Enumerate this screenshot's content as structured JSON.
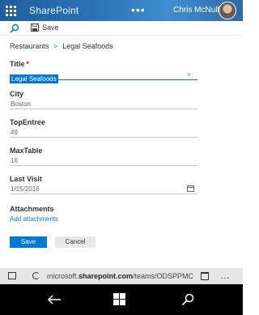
{
  "suitebar": {
    "app_name": "SharePoint",
    "more": "•••",
    "user_name": "Chris McNulty",
    "waffle_icon": "app-launcher-icon"
  },
  "commandbar": {
    "search_icon": "search-icon",
    "save_label": "Save"
  },
  "breadcrumb": {
    "list": "Restaurants",
    "separator": ">",
    "item": "Legal Seafoods"
  },
  "form": {
    "title_label": "Title",
    "title_required": "*",
    "title_value": "Legal Seafoods",
    "city_label": "City",
    "city_value": "Boston",
    "topentree_label": "TopEntree",
    "topentree_value": "49",
    "maxtable_label": "MaxTable",
    "maxtable_value": "16",
    "lastvisit_label": "Last Visit",
    "lastvisit_value": "1/15/2016",
    "attachments_label": "Attachments",
    "add_attachments": "Add attachments"
  },
  "buttons": {
    "save": "Save",
    "cancel": "Cancel"
  },
  "browser": {
    "url_prefix": "microsoft.",
    "url_domain": "sharepoint.com",
    "url_suffix": "/teams/ODSPPMC",
    "more": "…"
  },
  "colors": {
    "accent": "#0078d4",
    "suitebar": "#2a74b8",
    "required": "#cc0000"
  }
}
